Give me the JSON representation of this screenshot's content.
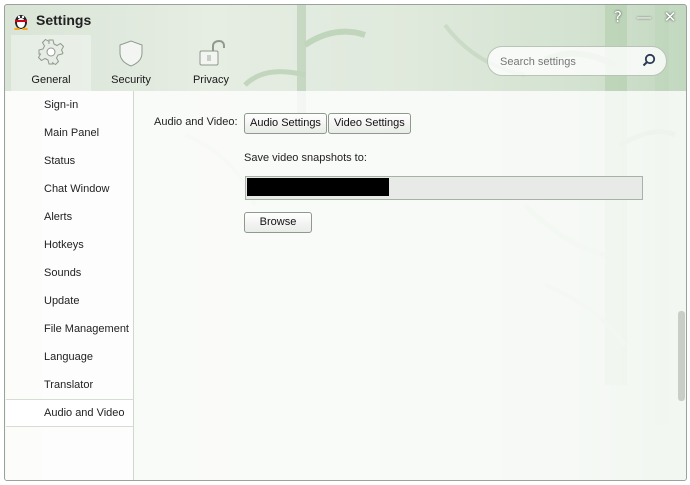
{
  "window": {
    "title": "Settings",
    "icon": "penguin-icon",
    "controls": [
      {
        "name": "help-icon",
        "glyph": "?"
      },
      {
        "name": "minimize-icon",
        "glyph": "—"
      },
      {
        "name": "close-icon",
        "glyph": "✕"
      }
    ]
  },
  "tabs": [
    {
      "label": "General",
      "icon": "gear-icon",
      "active": true
    },
    {
      "label": "Security",
      "icon": "shield-icon",
      "active": false
    },
    {
      "label": "Privacy",
      "icon": "lock-icon",
      "active": false
    }
  ],
  "search": {
    "placeholder": "Search settings",
    "icon": "search-icon"
  },
  "sidebar": {
    "items": [
      {
        "label": "Sign-in"
      },
      {
        "label": "Main Panel"
      },
      {
        "label": "Status"
      },
      {
        "label": "Chat Window"
      },
      {
        "label": "Alerts"
      },
      {
        "label": "Hotkeys"
      },
      {
        "label": "Sounds"
      },
      {
        "label": "Update"
      },
      {
        "label": "File Management"
      },
      {
        "label": "Language"
      },
      {
        "label": "Translator"
      },
      {
        "label": "Audio and Video",
        "active": true
      }
    ]
  },
  "main": {
    "audio_video_label": "Audio and Video:",
    "audio_settings_button": "Audio Settings",
    "video_settings_button": "Video Settings",
    "snapshot_label": "Save video snapshots to:",
    "snapshot_path": "",
    "browse_button": "Browse"
  },
  "colors": {
    "accent": "#5a8a4e",
    "redaction": "#000000"
  }
}
